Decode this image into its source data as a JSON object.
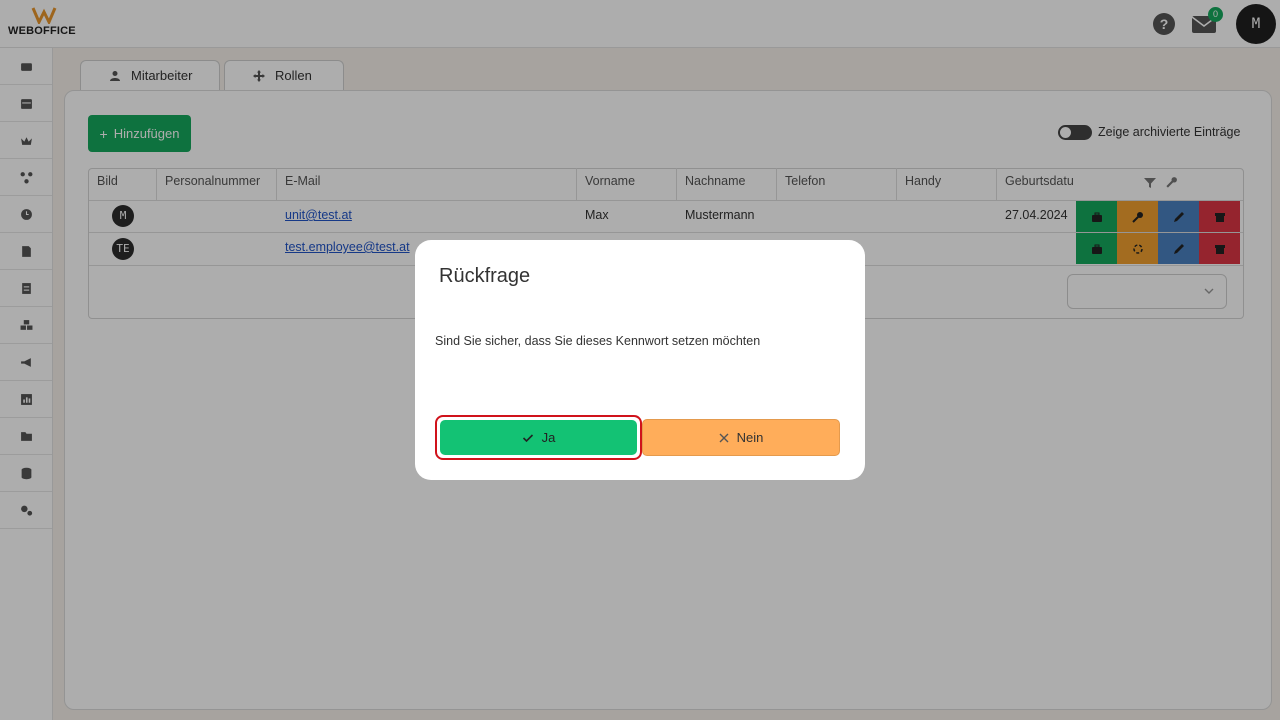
{
  "header": {
    "logo_text": "WEBOFFICE",
    "help_label": "?",
    "mail_count": "0",
    "user_initial": "M"
  },
  "sidebar": {
    "items": [
      {
        "icon": "inbox-icon"
      },
      {
        "icon": "calendar-icon"
      },
      {
        "icon": "crown-icon"
      },
      {
        "icon": "network-icon"
      },
      {
        "icon": "clock-icon"
      },
      {
        "icon": "document-icon"
      },
      {
        "icon": "list-document-icon"
      },
      {
        "icon": "cubes-icon"
      },
      {
        "icon": "megaphone-icon"
      },
      {
        "icon": "chart-icon"
      },
      {
        "icon": "folder-icon"
      },
      {
        "icon": "database-icon"
      },
      {
        "icon": "settings-icon"
      }
    ]
  },
  "tabs": [
    {
      "label": "Mitarbeiter",
      "icon": "user-icon"
    },
    {
      "label": "Rollen",
      "icon": "move-icon"
    }
  ],
  "toolbar": {
    "add_label": "Hinzufügen",
    "archive_toggle_label": "Zeige archivierte Einträge"
  },
  "table": {
    "columns": [
      "Bild",
      "Personalnummer",
      "E-Mail",
      "Vorname",
      "Nachname",
      "Telefon",
      "Handy",
      "Geburtsdatu"
    ],
    "rows": [
      {
        "avatar": "M",
        "personalnummer": "",
        "email": "unit@test.at",
        "vorname": "Max",
        "nachname": "Mustermann",
        "telefon": "",
        "handy": "",
        "geburtsdatum": "27.04.2024"
      },
      {
        "avatar": "TE",
        "personalnummer": "",
        "email": "test.employee@test.at",
        "vorname": "",
        "nachname": "",
        "telefon": "",
        "handy": "",
        "geburtsdatum": ""
      }
    ],
    "action_colors": {
      "login": "#16a85d",
      "key": "#f0a030",
      "edit": "#4a80c0",
      "archive": "#dc3545"
    }
  },
  "dialog": {
    "title": "Rückfrage",
    "message": "Sind Sie sicher, dass Sie dieses Kennwort setzen möchten",
    "confirm_label": "Ja",
    "cancel_label": "Nein"
  }
}
